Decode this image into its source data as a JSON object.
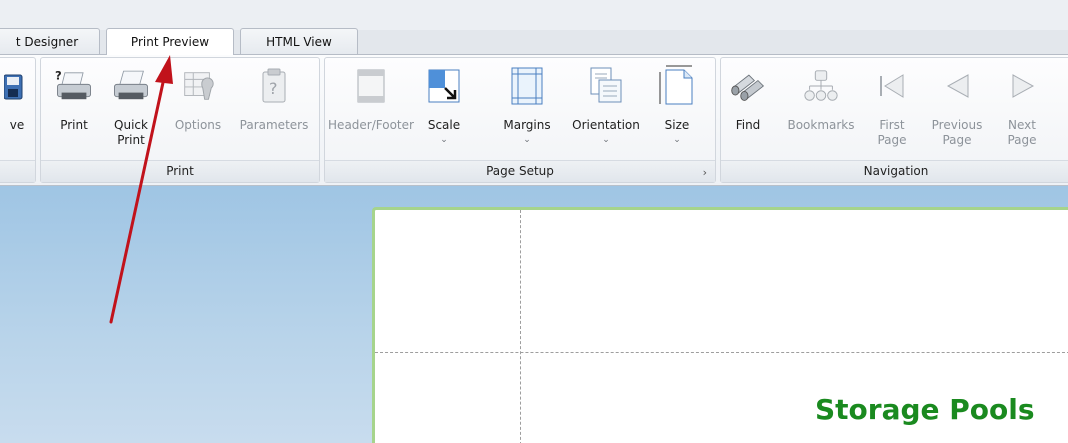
{
  "tabs": [
    {
      "label": "t Designer"
    },
    {
      "label": "Print Preview",
      "active": true
    },
    {
      "label": "HTML View"
    }
  ],
  "ribbon": {
    "left_partial": {
      "button_label": "ve"
    },
    "print_group": {
      "label": "Print",
      "buttons": [
        {
          "label": "Print",
          "icon": "printer-help-icon"
        },
        {
          "label": "Quick\nPrint",
          "icon": "quick-print-icon"
        },
        {
          "label": "Options",
          "icon": "options-icon",
          "disabled": true
        },
        {
          "label": "Parameters",
          "icon": "parameters-icon",
          "disabled": true
        }
      ]
    },
    "page_setup_group": {
      "label": "Page Setup",
      "launcher": "›",
      "buttons": [
        {
          "label": "Header/Footer",
          "icon": "header-footer-icon",
          "disabled": true
        },
        {
          "label": "Scale",
          "icon": "scale-icon",
          "dropdown": "⌄"
        },
        {
          "label": "Margins",
          "icon": "margins-icon",
          "dropdown": "⌄"
        },
        {
          "label": "Orientation",
          "icon": "orientation-icon",
          "dropdown": "⌄"
        },
        {
          "label": "Size",
          "icon": "size-icon",
          "dropdown": "⌄"
        }
      ]
    },
    "navigation_group": {
      "label": "Navigation",
      "buttons": [
        {
          "label": "Find",
          "icon": "binoculars-icon"
        },
        {
          "label": "Bookmarks",
          "icon": "bookmarks-icon",
          "disabled": true
        },
        {
          "label": "First\nPage",
          "icon": "first-page-icon",
          "disabled": true
        },
        {
          "label": "Previous\nPage",
          "icon": "previous-page-icon",
          "disabled": true
        },
        {
          "label": "Next\nPage",
          "icon": "next-page-icon",
          "disabled": true
        }
      ]
    }
  },
  "document": {
    "title": "Storage Pools"
  },
  "colors": {
    "title_green": "#1a8a1f",
    "annotation_arrow": "#c1121b",
    "workspace_blue": "#a9cbe7"
  }
}
